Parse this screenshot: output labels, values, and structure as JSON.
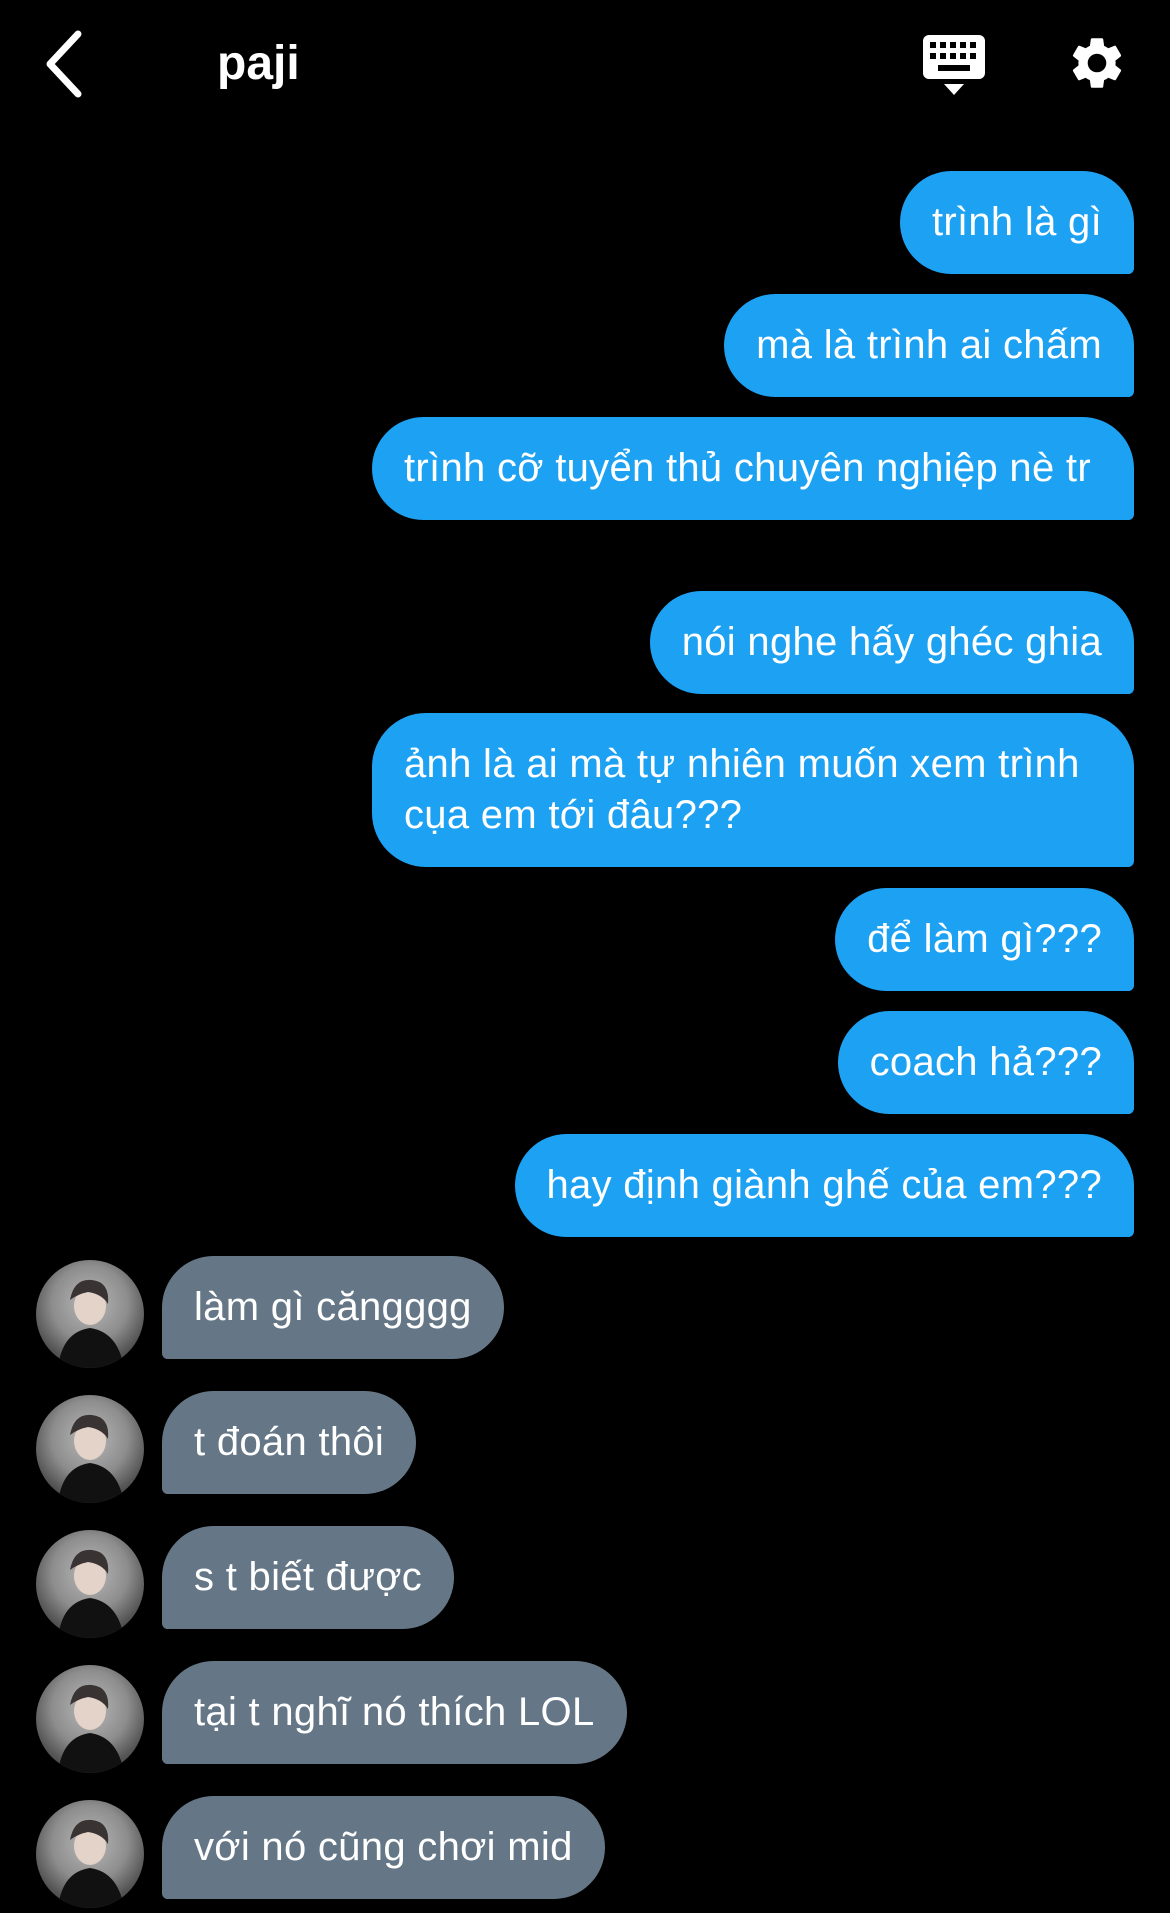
{
  "header": {
    "title": "paji",
    "back_icon": "chevron-left-icon",
    "keyboard_icon": "keyboard-icon",
    "settings_icon": "gear-icon"
  },
  "colors": {
    "background": "#000000",
    "outgoing_bubble": "#1da1f2",
    "incoming_bubble": "#657786",
    "text": "#ffffff"
  },
  "messages": [
    {
      "side": "out",
      "text": "trình là gì"
    },
    {
      "side": "out",
      "text": "mà là trình ai chấm"
    },
    {
      "side": "out",
      "text": "trình cỡ tuyển thủ chuyên nghiệp nè tr"
    },
    {
      "side": "out",
      "text": "nói nghe hấy ghéc ghia"
    },
    {
      "side": "out",
      "text": "ảnh là ai mà tự nhiên muốn xem trình cụa em tới đâu???"
    },
    {
      "side": "out",
      "text": "để làm gì???"
    },
    {
      "side": "out",
      "text": "coach hả???"
    },
    {
      "side": "out",
      "text": "hay định giành ghế của em???"
    },
    {
      "side": "in",
      "text": "làm gì căngggg"
    },
    {
      "side": "in",
      "text": "t đoán thôi"
    },
    {
      "side": "in",
      "text": "s t biết được"
    },
    {
      "side": "in",
      "text": "tại t nghĩ nó thích LOL"
    },
    {
      "side": "in",
      "text": "với nó cũng chơi mid"
    }
  ]
}
